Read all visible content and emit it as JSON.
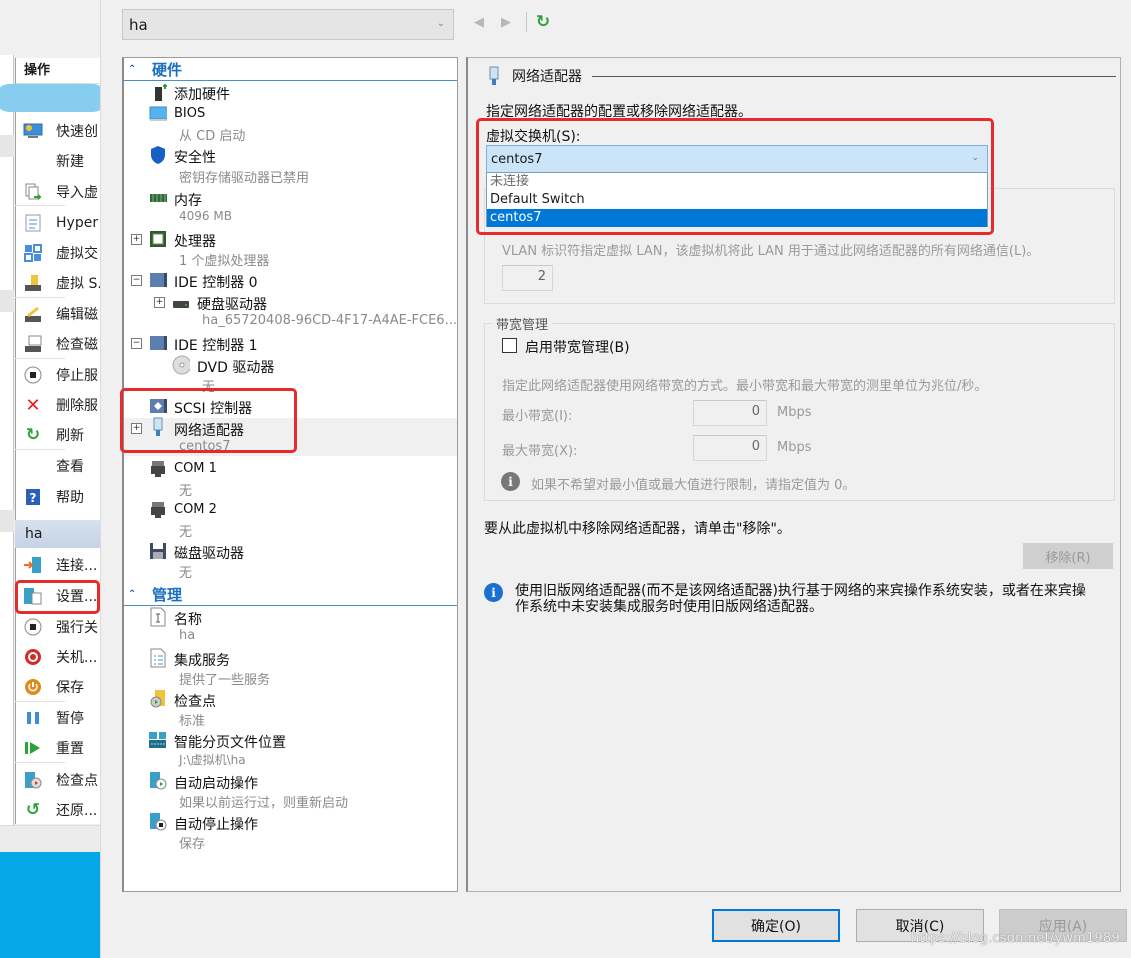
{
  "background_manager": {
    "actions_header": "操作",
    "items": [
      {
        "label": "快速创",
        "icon": "quick-create-icon"
      },
      {
        "label": "新建",
        "icon": ""
      },
      {
        "label": "导入虚",
        "icon": "import-icon"
      },
      {
        "label": "Hyper",
        "icon": "settings-doc-icon"
      },
      {
        "label": "虚拟交",
        "icon": "virtual-switch-icon"
      },
      {
        "label": "虚拟 S.",
        "icon": "virtual-san-icon"
      },
      {
        "label": "编辑磁",
        "icon": "edit-disk-icon"
      },
      {
        "label": "检查磁",
        "icon": "inspect-disk-icon"
      },
      {
        "label": "停止服",
        "icon": "stop-icon"
      },
      {
        "label": "删除服",
        "icon": "delete-icon"
      },
      {
        "label": "刷新",
        "icon": "refresh-icon"
      },
      {
        "label": "查看",
        "icon": ""
      },
      {
        "label": "帮助",
        "icon": "help-icon"
      }
    ],
    "vm_section_title": "ha",
    "vm_items": [
      {
        "label": "连接...",
        "icon": "connect-icon"
      },
      {
        "label": "设置...",
        "icon": "settings-icon"
      },
      {
        "label": "强行关",
        "icon": "turn-off-icon"
      },
      {
        "label": "关机...",
        "icon": "shutdown-icon"
      },
      {
        "label": "保存",
        "icon": "save-icon"
      },
      {
        "label": "暂停",
        "icon": "pause-icon"
      },
      {
        "label": "重置",
        "icon": "reset-icon"
      },
      {
        "label": "检查点",
        "icon": "checkpoint-icon"
      },
      {
        "label": "还原...",
        "icon": "revert-icon"
      }
    ]
  },
  "dialog": {
    "vm_selector": "ha",
    "tree": {
      "hardware_title": "硬件",
      "management_title": "管理",
      "hardware_items": [
        {
          "name": "添加硬件",
          "sub": ""
        },
        {
          "name": "BIOS",
          "sub": "从 CD 启动"
        },
        {
          "name": "安全性",
          "sub": "密钥存储驱动器已禁用"
        },
        {
          "name": "内存",
          "sub": "4096 MB"
        },
        {
          "name": "处理器",
          "sub": "1 个虚拟处理器"
        },
        {
          "name": "IDE 控制器 0",
          "sub": ""
        },
        {
          "name": "硬盘驱动器",
          "sub": "ha_65720408-96CD-4F17-A4AE-FCE6..."
        },
        {
          "name": "IDE 控制器 1",
          "sub": ""
        },
        {
          "name": "DVD 驱动器",
          "sub": "无"
        },
        {
          "name": "SCSI 控制器",
          "sub": ""
        },
        {
          "name": "网络适配器",
          "sub": "centos7"
        },
        {
          "name": "COM 1",
          "sub": "无"
        },
        {
          "name": "COM 2",
          "sub": "无"
        },
        {
          "name": "磁盘驱动器",
          "sub": "无"
        }
      ],
      "management_items": [
        {
          "name": "名称",
          "sub": "ha"
        },
        {
          "name": "集成服务",
          "sub": "提供了一些服务"
        },
        {
          "name": "检查点",
          "sub": "标准"
        },
        {
          "name": "智能分页文件位置",
          "sub": "J:\\虚拟机\\ha"
        },
        {
          "name": "自动启动操作",
          "sub": "如果以前运行过，则重新启动"
        },
        {
          "name": "自动停止操作",
          "sub": "保存"
        }
      ]
    },
    "detail": {
      "title": "网络适配器",
      "description": "指定网络适配器的配置或移除网络适配器。",
      "switch_label": "虚拟交换机(S):",
      "switch_value": "centos7",
      "switch_options": [
        "未连接",
        "Default Switch",
        "centos7"
      ],
      "vlan_text": "VLAN 标识符指定虚拟 LAN，该虚拟机将此 LAN 用于通过此网络适配器的所有网络通信(L)。",
      "vlan_value": "2",
      "bandwidth_group": "带宽管理",
      "bandwidth_checkbox": "启用带宽管理(B)",
      "bandwidth_enabled": false,
      "bandwidth_desc": "指定此网络适配器使用网络带宽的方式。最小带宽和最大带宽的测里单位为兆位/秒。",
      "min_bw_label": "最小带宽(I):",
      "min_bw_value": "0",
      "max_bw_label": "最大带宽(X):",
      "max_bw_value": "0",
      "unit": "Mbps",
      "bw_info": "如果不希望对最小值或最大值进行限制，请指定值为 0。",
      "remove_text": "要从此虚拟机中移除网络适配器，请单击\"移除\"。",
      "remove_button": "移除(R)",
      "legacy_info": "使用旧版网络适配器(而不是该网络适配器)执行基于网络的来宾操作系统安装，或者在来宾操作系统中未安装集成服务时使用旧版网络适配器。"
    },
    "buttons": {
      "ok": "确定(O)",
      "cancel": "取消(C)",
      "apply": "应用(A)"
    },
    "watermark": "https://blog.csdn.net/ywm1989"
  },
  "colors": {
    "accent": "#0078d7",
    "highlight_box": "#e52b2b",
    "section_title": "#1a6fc0"
  }
}
